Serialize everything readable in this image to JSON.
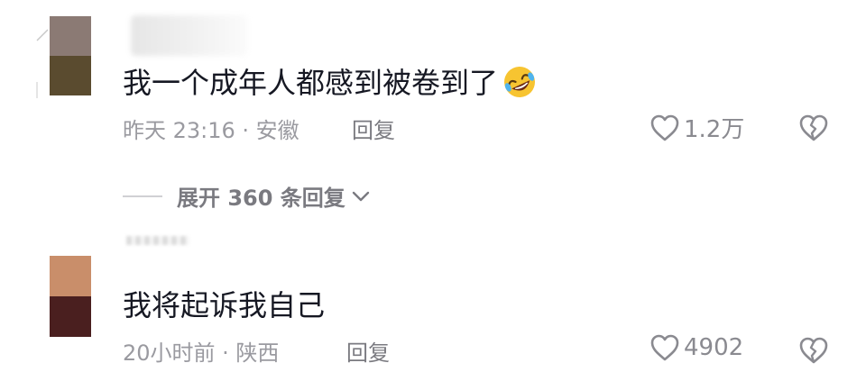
{
  "comments": [
    {
      "text": "我一个成年人都感到被卷到了",
      "emoji": "rofl-emoji",
      "time_location": "昨天 23:16 · 安徽",
      "reply_label": "回复",
      "likes": "1.2万",
      "avatar_colors": [
        "#8b7a74",
        "#5a4b2f"
      ],
      "expand_label": "展开 360 条回复"
    },
    {
      "text": "我将起诉我自己",
      "time_location": "20小时前 · 陕西",
      "reply_label": "回复",
      "likes": "4902",
      "avatar_colors": [
        "#c98e6a",
        "#4a1f1f"
      ]
    }
  ],
  "icons": {
    "like": "heart-outline-icon",
    "dislike": "broken-heart-icon",
    "expand": "chevron-down-icon"
  }
}
